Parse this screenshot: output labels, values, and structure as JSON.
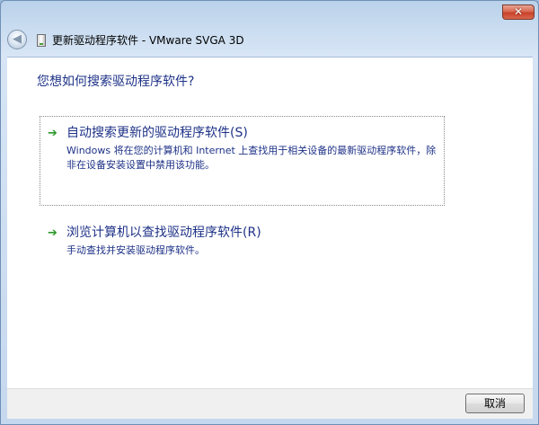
{
  "window": {
    "title": "更新驱动程序软件 - VMware SVGA 3D",
    "close_glyph": "✕",
    "back_glyph": "◀"
  },
  "content": {
    "question": "您想如何搜索驱动程序软件?",
    "options": [
      {
        "title": "自动搜索更新的驱动程序软件(S)",
        "description": "Windows 将在您的计算机和 Internet 上查找用于相关设备的最新驱动程序软件，除非在设备安装设置中禁用该功能。",
        "icon": "green-arrow-icon"
      },
      {
        "title": "浏览计算机以查找驱动程序软件(R)",
        "description": "手动查找并安装驱动程序软件。",
        "icon": "green-arrow-icon"
      }
    ],
    "arrow_glyph": "➔"
  },
  "footer": {
    "cancel_label": "取消"
  },
  "colors": {
    "link_text": "#1e3287",
    "arrow": "#2c9a2c",
    "close_button": "#c8412a"
  }
}
